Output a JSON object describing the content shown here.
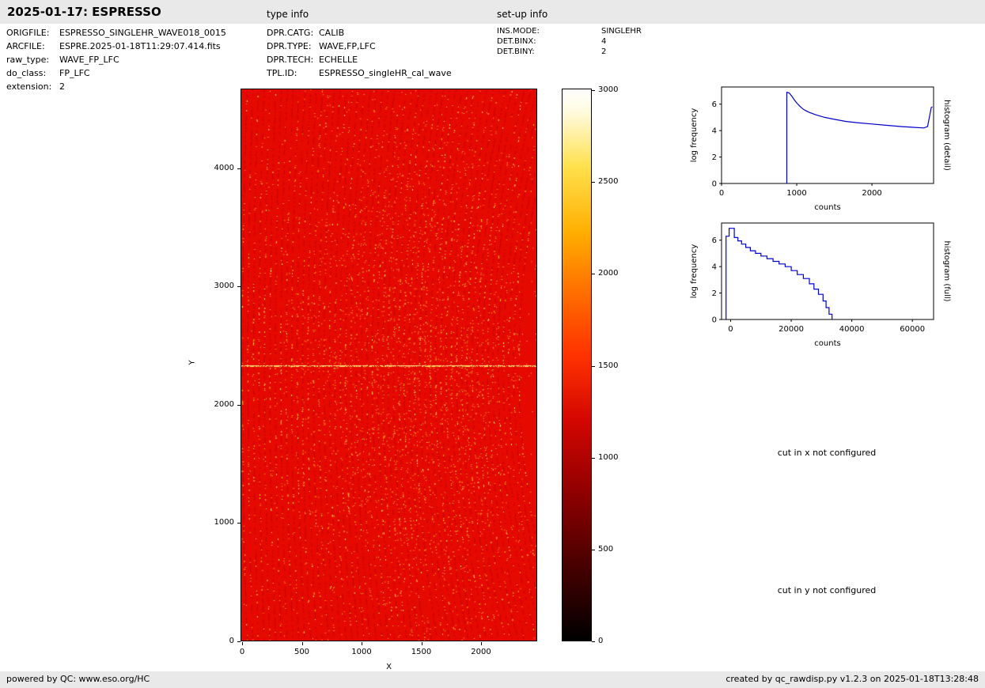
{
  "header": {
    "title": "2025-01-17: ESPRESSO",
    "type_info_label": "type info",
    "setup_info_label": "set-up info"
  },
  "file_info": {
    "rows": [
      {
        "label": "ORIGFILE:",
        "value": "ESPRESSO_SINGLEHR_WAVE018_0015"
      },
      {
        "label": "ARCFILE:",
        "value": "ESPRE.2025-01-18T11:29:07.414.fits"
      },
      {
        "label": "raw_type:",
        "value": "WAVE_FP_LFC"
      },
      {
        "label": "do_class:",
        "value": "FP_LFC"
      },
      {
        "label": "extension:",
        "value": "2"
      }
    ]
  },
  "type_info": {
    "rows": [
      {
        "label": "DPR.CATG:",
        "value": "CALIB"
      },
      {
        "label": "DPR.TYPE:",
        "value": "WAVE,FP,LFC"
      },
      {
        "label": "DPR.TECH:",
        "value": "ECHELLE"
      },
      {
        "label": "TPL.ID:",
        "value": "ESPRESSO_singleHR_cal_wave"
      }
    ]
  },
  "setup_info": {
    "rows": [
      {
        "label": "INS.MODE:",
        "value": "SINGLEHR"
      },
      {
        "label": "DET.BINX:",
        "value": "4"
      },
      {
        "label": "DET.BINY:",
        "value": "2"
      }
    ]
  },
  "messages": {
    "cut_x": "cut in x not configured",
    "cut_y": "cut in y not configured"
  },
  "footer": {
    "left": "powered by QC: www.eso.org/HC",
    "right": "created by qc_rawdisp.py v1.2.3 on 2025-01-18T13:28:48"
  },
  "chart_data": [
    {
      "type": "heatmap",
      "name": "raw-detector-image",
      "xlabel": "X",
      "ylabel": "Y",
      "x_ticks": [
        0,
        500,
        1000,
        1500,
        2000
      ],
      "y_ticks": [
        0,
        1000,
        2000,
        3000,
        4000
      ],
      "xlim": [
        0,
        2470
      ],
      "ylim": [
        0,
        4660
      ],
      "colormap": "hot",
      "colorbar_range": [
        0,
        3000
      ],
      "colorbar_ticks": [
        0,
        500,
        1000,
        1500,
        2000,
        2500,
        3000
      ],
      "background_color": "#e60900",
      "description": "raw echelle WAVE,FP,LFC frame: saturated red background with curved vertical order stripes of yellow emission speckles, denser speckling in the central region, and a bright horizontal feature near y=2320"
    },
    {
      "type": "line",
      "name": "histogram-detail",
      "xlabel": "counts",
      "ylabel": "log frequency",
      "right_label": "histogram (detail)",
      "x_ticks": [
        0,
        1000,
        2000
      ],
      "y_ticks": [
        0,
        2,
        4,
        6
      ],
      "xlim": [
        0,
        2820
      ],
      "ylim": [
        0,
        7.3
      ],
      "line_color": "#0000cc",
      "x": [
        868,
        868,
        900,
        935,
        965,
        1000,
        1040,
        1090,
        1160,
        1250,
        1370,
        1500,
        1650,
        1800,
        2000,
        2200,
        2400,
        2550,
        2690,
        2740,
        2790,
        2805
      ],
      "y": [
        0,
        6.9,
        6.85,
        6.6,
        6.35,
        6.1,
        5.85,
        5.6,
        5.4,
        5.2,
        5.0,
        4.85,
        4.7,
        4.6,
        4.5,
        4.4,
        4.3,
        4.25,
        4.2,
        4.3,
        5.75,
        5.8
      ]
    },
    {
      "type": "line",
      "name": "histogram-full",
      "xlabel": "counts",
      "ylabel": "log frequency",
      "right_label": "histogram (full)",
      "x_ticks": [
        0,
        20000,
        40000,
        60000
      ],
      "y_ticks": [
        0,
        2,
        4,
        6
      ],
      "xlim": [
        -3000,
        67000
      ],
      "ylim": [
        0,
        7.3
      ],
      "line_color": "#0000cc",
      "x": [
        -1500,
        -1500,
        -500,
        -500,
        1200,
        1200,
        2400,
        2400,
        3600,
        3600,
        5000,
        5000,
        6500,
        6500,
        8200,
        8200,
        10000,
        10000,
        12000,
        12000,
        14000,
        14000,
        16000,
        16000,
        18000,
        18000,
        20000,
        20000,
        22000,
        22000,
        24000,
        24000,
        26000,
        26000,
        27500,
        27500,
        29000,
        29000,
        30500,
        30500,
        31500,
        31500,
        32500,
        32500,
        33500,
        33500
      ],
      "y": [
        0,
        6.3,
        6.3,
        6.9,
        6.9,
        6.2,
        6.2,
        5.95,
        5.95,
        5.7,
        5.7,
        5.45,
        5.45,
        5.2,
        5.2,
        5.0,
        5.0,
        4.8,
        4.8,
        4.6,
        4.6,
        4.4,
        4.4,
        4.2,
        4.2,
        4.0,
        4.0,
        3.7,
        3.7,
        3.4,
        3.4,
        3.1,
        3.1,
        2.7,
        2.7,
        2.3,
        2.3,
        1.9,
        1.9,
        1.4,
        1.4,
        0.9,
        0.9,
        0.4,
        0.4,
        0
      ]
    }
  ]
}
